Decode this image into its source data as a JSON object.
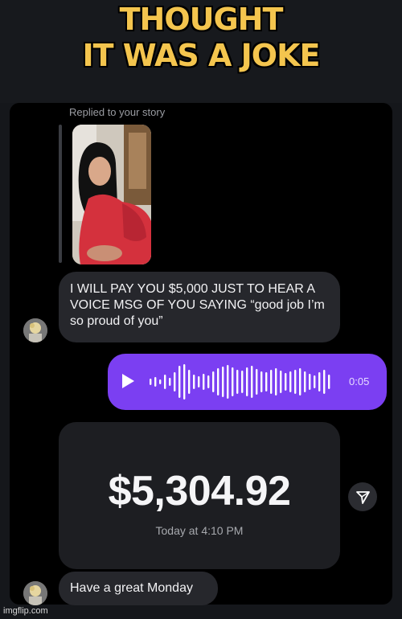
{
  "meme": {
    "title": "THOUGHT\nIT WAS A JOKE",
    "title_color": "#f4c54e"
  },
  "chat": {
    "reply_label": "Replied to your story",
    "story": {
      "type": "story-photo"
    },
    "messages": [
      {
        "sender": "them",
        "text": "I WILL PAY YOU $5,000 JUST TO HEAR A VOICE MSG OF YOU SAYING “good job I’m so proud of you”"
      },
      {
        "sender": "me",
        "type": "voice",
        "duration": "0:05",
        "icon": "play-icon",
        "accent": "#7b3ff2"
      },
      {
        "sender": "them",
        "type": "payment",
        "amount": "$5,304.92",
        "time": "Today at 4:10 PM",
        "share_icon": "send-icon"
      },
      {
        "sender": "them",
        "text": "Have a great Monday"
      }
    ]
  },
  "watermark": "imgflip.com"
}
